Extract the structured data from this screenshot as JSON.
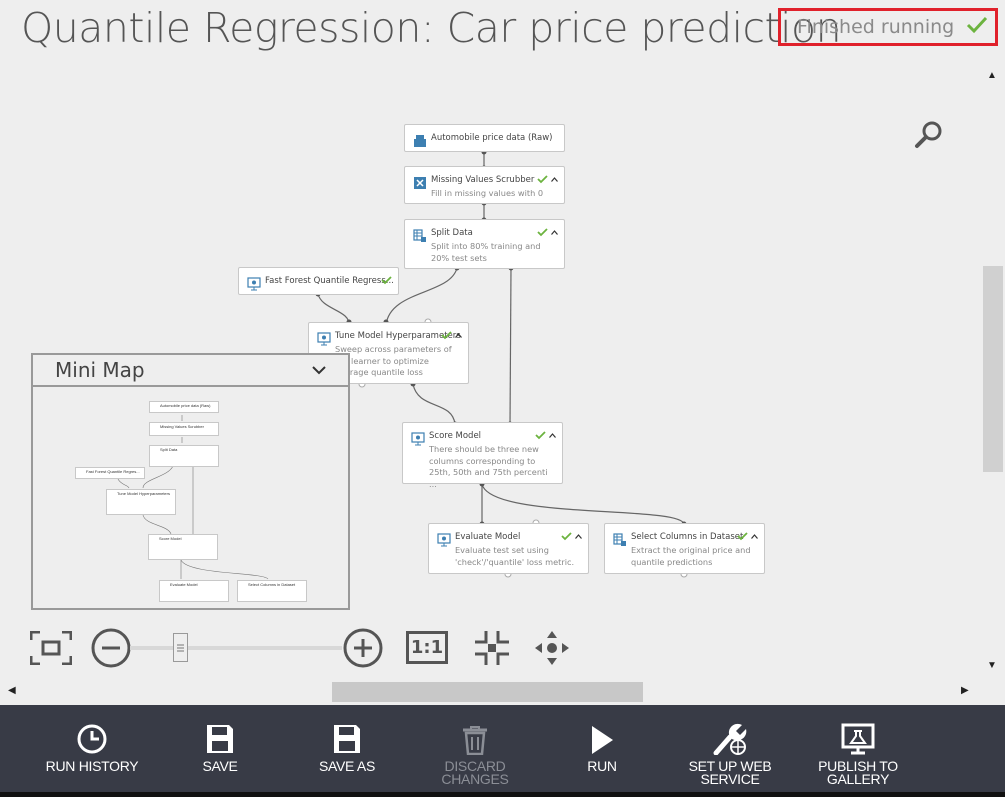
{
  "experiment": {
    "title": "Quantile Regression: Car price prediction",
    "status": "Finished running"
  },
  "modules": {
    "auto_data": {
      "title": "Automobile price data (Raw)"
    },
    "missing": {
      "title": "Missing Values Scrubber",
      "desc": "Fill in missing values with 0"
    },
    "split": {
      "title": "Split Data",
      "desc": "Split into 80% training and 20% test sets"
    },
    "fastforest": {
      "title": "Fast Forest Quantile Regress..."
    },
    "tune": {
      "title": "Tune Model Hyperparameters",
      "desc": "Sweep across parameters of the learner to optimize average quantile loss"
    },
    "score": {
      "title": "Score Model",
      "desc": "There should be three new columns corresponding to 25th, 50th and 75th percenti ..."
    },
    "evaluate": {
      "title": "Evaluate Model",
      "desc": "Evaluate test set using 'check'/'quantile' loss metric."
    },
    "select": {
      "title": "Select Columns in Dataset",
      "desc": "Extract the original price and quantile predictions"
    }
  },
  "minimap": {
    "title": "Mini Map"
  },
  "canvas_controls": {
    "actual_size_label": "1:1"
  },
  "toolbar": {
    "run_history": "RUN HISTORY",
    "save": "SAVE",
    "save_as": "SAVE AS",
    "discard": "DISCARD CHANGES",
    "run": "RUN",
    "web_service_line1": "SET UP WEB",
    "web_service_line2": "SERVICE",
    "publish_line1": "PUBLISH TO",
    "publish_line2": "GALLERY"
  },
  "colors": {
    "status_border": "#e0212b",
    "check_green": "#6cb33f",
    "toolbar_bg": "#383b46",
    "icon_blue": "#3d7fb1"
  },
  "icons": [
    "check-icon",
    "collapse-chevron-icon",
    "magnify-icon",
    "fit-screen-icon",
    "zoom-out-icon",
    "zoom-in-icon",
    "actual-size-icon",
    "zoom-selection-icon",
    "pan-icon",
    "history-icon",
    "save-icon",
    "save-as-icon",
    "trash-icon",
    "play-icon",
    "web-service-icon",
    "publish-icon"
  ]
}
